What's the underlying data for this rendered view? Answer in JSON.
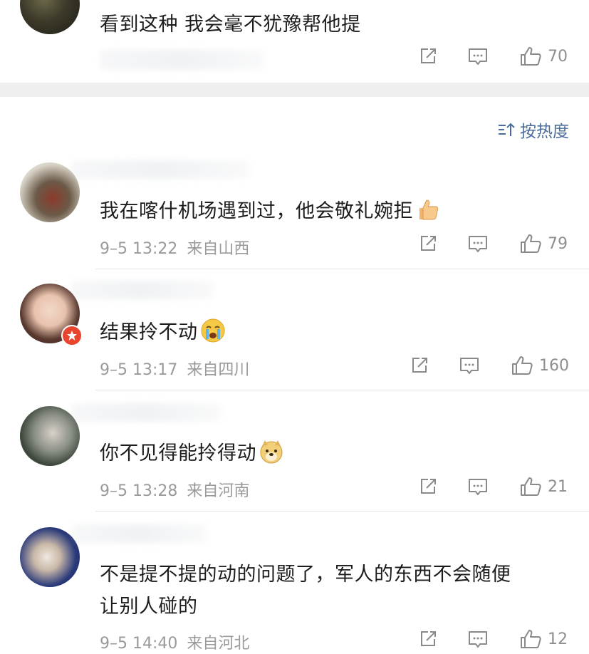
{
  "top_comment": {
    "text": "看到这种 我会毫不犹豫帮他提",
    "like_count": "70"
  },
  "sort": {
    "label": "按热度"
  },
  "comments": [
    {
      "text": "我在喀什机场遇到过，他会敬礼婉拒",
      "emoji": "thumbs-up-emoji",
      "time": "9–5 13:22",
      "location": "来自山西",
      "like_count": "79"
    },
    {
      "text": "结果拎不动",
      "emoji": "crying-face-emoji",
      "time": "9–5 13:17",
      "location": "来自四川",
      "like_count": "160"
    },
    {
      "text": "你不见得能拎得动",
      "emoji": "doge-emoji",
      "time": "9–5 13:28",
      "location": "来自河南",
      "like_count": "21"
    },
    {
      "text_line1": "不是提不提的动的问题了，军人的东西不会随便",
      "text_line2": "让别人碰的",
      "time": "9–5 14:40",
      "location": "来自河北",
      "like_count": "12"
    }
  ],
  "icons": {
    "share": "share-icon",
    "comment": "comment-icon",
    "like": "like-icon",
    "sort": "sort-icon"
  },
  "colors": {
    "sort_text": "#4c6d9b",
    "meta_text": "#9a9a9a",
    "badge": "#e8442e"
  }
}
